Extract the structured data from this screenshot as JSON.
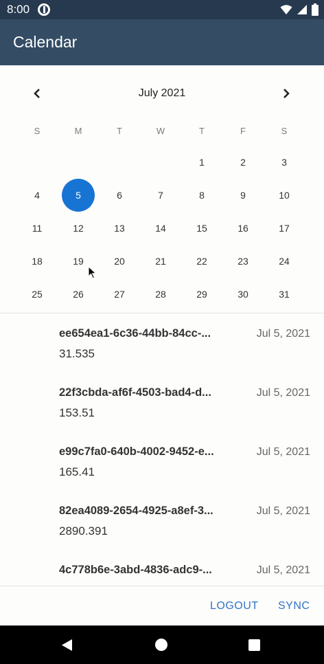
{
  "status_bar": {
    "time": "8:00"
  },
  "app_bar": {
    "title": "Calendar"
  },
  "calendar": {
    "month_label": "July 2021",
    "weekdays": [
      "S",
      "M",
      "T",
      "W",
      "T",
      "F",
      "S"
    ],
    "weeks": [
      [
        "",
        "",
        "",
        "",
        "1",
        "2",
        "3"
      ],
      [
        "4",
        "5",
        "6",
        "7",
        "8",
        "9",
        "10"
      ],
      [
        "11",
        "12",
        "13",
        "14",
        "15",
        "16",
        "17"
      ],
      [
        "18",
        "19",
        "20",
        "21",
        "22",
        "23",
        "24"
      ],
      [
        "25",
        "26",
        "27",
        "28",
        "29",
        "30",
        "31"
      ]
    ],
    "selected_day": "5",
    "accent_color": "#1874d2"
  },
  "entries": [
    {
      "id": "ee654ea1-6c36-44bb-84cc-...",
      "date": "Jul 5, 2021",
      "amount": "31.535"
    },
    {
      "id": "22f3cbda-af6f-4503-bad4-d...",
      "date": "Jul 5, 2021",
      "amount": "153.51"
    },
    {
      "id": "e99c7fa0-640b-4002-9452-e...",
      "date": "Jul 5, 2021",
      "amount": "165.41"
    },
    {
      "id": "82ea4089-2654-4925-a8ef-3...",
      "date": "Jul 5, 2021",
      "amount": "2890.391"
    },
    {
      "id": "4c778b6e-3abd-4836-adc9-...",
      "date": "Jul 5, 2021",
      "amount": ""
    }
  ],
  "footer": {
    "logout_label": "LOGOUT",
    "sync_label": "SYNC"
  },
  "colors": {
    "app_bar": "#344c64",
    "status_bar": "#26394f",
    "button_text": "#3274c8"
  },
  "icons": {
    "prev": "chevron-left-icon",
    "next": "chevron-right-icon",
    "wifi": "wifi-icon",
    "signal": "signal-icon",
    "battery": "battery-icon",
    "back": "back-triangle-icon",
    "home": "home-circle-icon",
    "recents": "recents-square-icon"
  }
}
